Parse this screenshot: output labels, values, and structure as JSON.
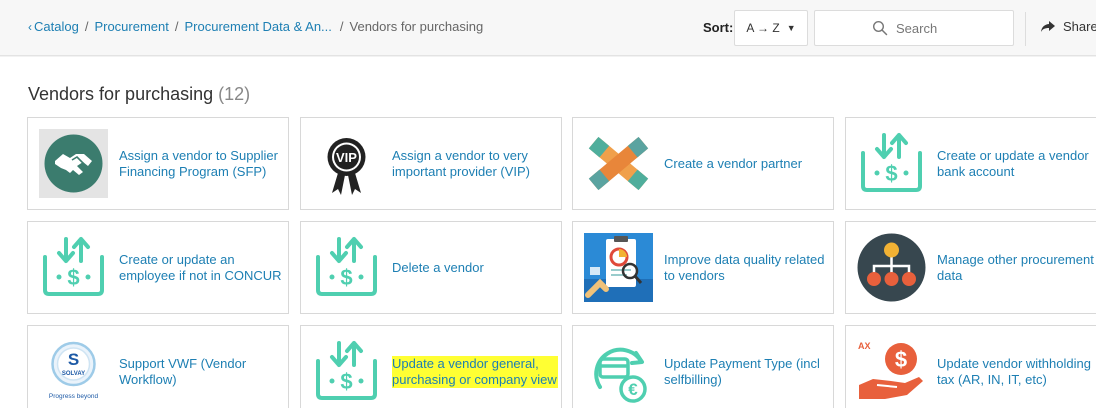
{
  "breadcrumb": {
    "items": [
      "Catalog",
      "Procurement",
      "Procurement Data & An...",
      "Vendors for purchasing"
    ]
  },
  "sort": {
    "label": "Sort:",
    "value": "A → Z"
  },
  "search": {
    "placeholder": "Search"
  },
  "share": {
    "label": "Share"
  },
  "page": {
    "title": "Vendors for purchasing",
    "count": "(12)"
  },
  "tiles": [
    {
      "label": "Assign a vendor to Supplier Financing Program (SFP)",
      "icon": "handshake-icon"
    },
    {
      "label": "Assign a vendor to very important provider (VIP)",
      "icon": "vip-badge-icon"
    },
    {
      "label": "Create a vendor partner",
      "icon": "partner-hands-icon"
    },
    {
      "label": "Create or update a vendor bank account",
      "icon": "money-transfer-icon"
    },
    {
      "label": "Create or update an employee if not in CONCUR",
      "icon": "money-transfer-icon"
    },
    {
      "label": "Delete a vendor",
      "icon": "money-transfer-icon"
    },
    {
      "label": "Improve data quality related to vendors",
      "icon": "data-analysis-icon"
    },
    {
      "label": "Manage other procurement data",
      "icon": "org-chart-icon"
    },
    {
      "label": "Support VWF (Vendor Workflow)",
      "icon": "solvay-logo-icon",
      "logo_text": "SOLVAY",
      "logo_tagline": "Progress beyond"
    },
    {
      "label": "Update a vendor general, purchasing or company view",
      "icon": "money-transfer-icon",
      "highlighted": true
    },
    {
      "label": "Update Payment Type (incl selfbilling)",
      "icon": "payment-euro-icon"
    },
    {
      "label": "Update vendor withholding tax (AR, IN, IT, etc)",
      "icon": "tax-hand-icon",
      "icon_text": "AX"
    }
  ],
  "colors": {
    "link": "#1d7fb3",
    "teal": "#4fcfb0",
    "highlight": "#ffff33"
  }
}
